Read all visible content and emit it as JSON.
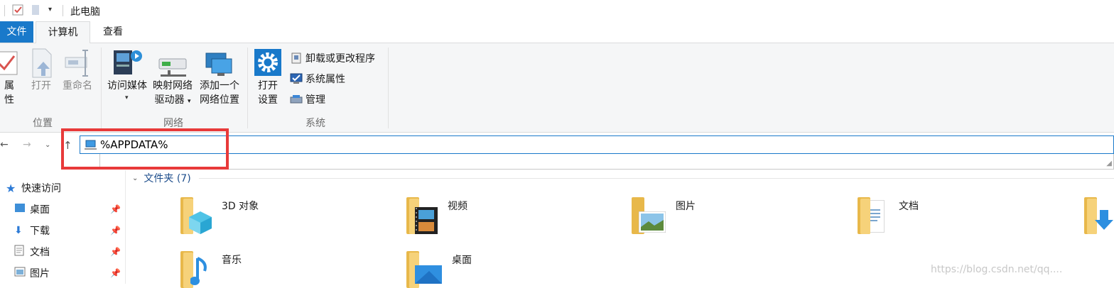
{
  "window": {
    "title": "此电脑"
  },
  "tabs": [
    {
      "label": "文件"
    },
    {
      "label": "计算机"
    },
    {
      "label": "查看"
    }
  ],
  "ribbon": {
    "location_group": {
      "label": "位置",
      "buttons": [
        {
          "label": "属性",
          "enabled": true
        },
        {
          "label": "打开",
          "enabled": false
        },
        {
          "label": "重命名",
          "enabled": false
        }
      ]
    },
    "network_group": {
      "label": "网络",
      "buttons": [
        {
          "label": "访问媒体"
        },
        {
          "label_line1": "映射网络",
          "label_line2": "驱动器"
        },
        {
          "label_line1": "添加一个",
          "label_line2": "网络位置"
        }
      ]
    },
    "system_group": {
      "label": "系统",
      "open_settings": {
        "line1": "打开",
        "line2": "设置"
      },
      "items": [
        {
          "label": "卸载或更改程序"
        },
        {
          "label": "系统属性"
        },
        {
          "label": "管理"
        }
      ]
    }
  },
  "address_bar": {
    "value": "%APPDATA%"
  },
  "nav_pane": {
    "items": [
      {
        "label": "快速访问",
        "pinned": false
      },
      {
        "label": "桌面",
        "pinned": true
      },
      {
        "label": "下载",
        "pinned": true
      },
      {
        "label": "文档",
        "pinned": true
      },
      {
        "label": "图片",
        "pinned": true
      }
    ]
  },
  "content": {
    "section_header": "文件夹 (7)",
    "folders": [
      {
        "name": "3D 对象"
      },
      {
        "name": "视频"
      },
      {
        "name": "图片"
      },
      {
        "name": "文档"
      },
      {
        "name": "音乐"
      },
      {
        "name": "桌面"
      }
    ]
  },
  "watermark": "https://blog.csdn.net/qq...."
}
